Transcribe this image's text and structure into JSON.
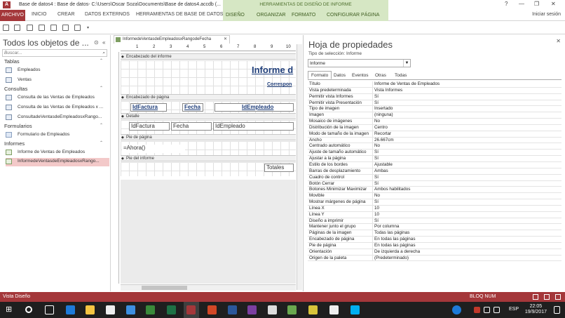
{
  "window": {
    "title": "Base de datos4 : Base de datos- C:\\Users\\Oscar Soza\\Documents\\Base de datos4.accdb (...",
    "context_group": "HERRAMIENTAS DE DISEÑO DE INFORME",
    "controls": [
      "?",
      "—",
      "❐",
      "✕"
    ]
  },
  "ribbon": {
    "file_tab": "ARCHIVO",
    "tabs": [
      "INICIO",
      "CREAR",
      "DATOS EXTERNOS",
      "HERRAMIENTAS DE BASE DE DATOS"
    ],
    "context_tabs": [
      "DISEÑO",
      "ORGANIZAR",
      "FORMATO",
      "CONFIGURAR PÁGINA"
    ],
    "sign_in": "Iniciar sesión"
  },
  "nav": {
    "title": "Todos los objetos de ...",
    "search_placeholder": "Buscar...",
    "groups": [
      {
        "label": "Tablas",
        "items": [
          "Empleados",
          "Ventas"
        ]
      },
      {
        "label": "Consultas",
        "items": [
          "Consulta de las Ventas de Empleados",
          "Consulta de las Ventas de Empleados x ...",
          "ConsultadeVentasdeEmpleadosxRango..."
        ]
      },
      {
        "label": "Formularios",
        "items": [
          "Formulario de Empleados"
        ]
      },
      {
        "label": "Informes",
        "items": [
          "Informe de Ventas de Empleados",
          "InformedeVentasdeEmpleadosxRango..."
        ]
      }
    ]
  },
  "document": {
    "tab_label": "InformedeVentasdeEmpleadosxRangodeFecha",
    "sections": {
      "report_header": "Encabezado del informe",
      "page_header": "Encabezado de página",
      "detail": "Detalle",
      "page_footer": "Pie de página",
      "report_footer": "Pie del informe"
    },
    "report_title": "Informe d",
    "corresp": "Correspon",
    "header_labels": [
      "IdFactura",
      "Fecha",
      "IdEmpleado"
    ],
    "detail_fields": [
      "IdFactura",
      "Fecha",
      "IdEmpleado"
    ],
    "now_field": "=Ahora()",
    "totals_label": "Totales",
    "ruler_marks": [
      "1",
      "2",
      "3",
      "4",
      "5",
      "6",
      "7",
      "8",
      "9",
      "10"
    ]
  },
  "properties": {
    "title": "Hoja de propiedades",
    "selection_type_label": "Tipo de selección:",
    "selection_type": "Informe",
    "selected_object": "Informe",
    "tabs": [
      "Formato",
      "Datos",
      "Eventos",
      "Otras",
      "Todas"
    ],
    "active_tab": "Formato",
    "rows": [
      {
        "k": "Título",
        "v": "Informe de Ventas de Empleados"
      },
      {
        "k": "Vista predeterminada",
        "v": "Vista Informes"
      },
      {
        "k": "Permitir vista Informes",
        "v": "Sí"
      },
      {
        "k": "Permitir vista Presentación",
        "v": "Sí"
      },
      {
        "k": "Tipo de imagen",
        "v": "Insertado"
      },
      {
        "k": "Imagen",
        "v": "(ninguna)"
      },
      {
        "k": "Mosaico de imágenes",
        "v": "No"
      },
      {
        "k": "Distribución de la imagen",
        "v": "Centro"
      },
      {
        "k": "Modo de tamaño de la imagen",
        "v": "Recortar"
      },
      {
        "k": "Ancho",
        "v": "26.667cm"
      },
      {
        "k": "Centrado automático",
        "v": "No"
      },
      {
        "k": "Ajuste de tamaño automático",
        "v": "Sí"
      },
      {
        "k": "Ajustar a la página",
        "v": "Sí"
      },
      {
        "k": "Estilo de los bordes",
        "v": "Ajustable"
      },
      {
        "k": "Barras de desplazamiento",
        "v": "Ambas"
      },
      {
        "k": "Cuadro de control",
        "v": "Sí"
      },
      {
        "k": "Botón Cerrar",
        "v": "Sí"
      },
      {
        "k": "Botones Minimizar Maximizar",
        "v": "Ambos habilitados"
      },
      {
        "k": "Movible",
        "v": "No"
      },
      {
        "k": "Mostrar márgenes de página",
        "v": "Sí"
      },
      {
        "k": "Línea X",
        "v": "10"
      },
      {
        "k": "Línea Y",
        "v": "10"
      },
      {
        "k": "Diseño a imprimir",
        "v": "Sí"
      },
      {
        "k": "Mantener junto el grupo",
        "v": "Por columna"
      },
      {
        "k": "Páginas de la imagen",
        "v": "Todas las páginas"
      },
      {
        "k": "Encabezado de página",
        "v": "En todas las páginas"
      },
      {
        "k": "Pie de página",
        "v": "En todas las páginas"
      },
      {
        "k": "Orientación",
        "v": "De izquierda a derecha"
      },
      {
        "k": "Origen de la paleta",
        "v": "(Predeterminado)"
      }
    ]
  },
  "status": {
    "left": "Vista Diseño",
    "right": "BLOQ NUM"
  },
  "taskbar": {
    "lang": "ESP",
    "time": "22:05",
    "date": "19/9/2017"
  },
  "colors": {
    "access_red": "#a4373a",
    "context_green": "#d6e7c4",
    "taskbar": "#1f1f1f"
  }
}
